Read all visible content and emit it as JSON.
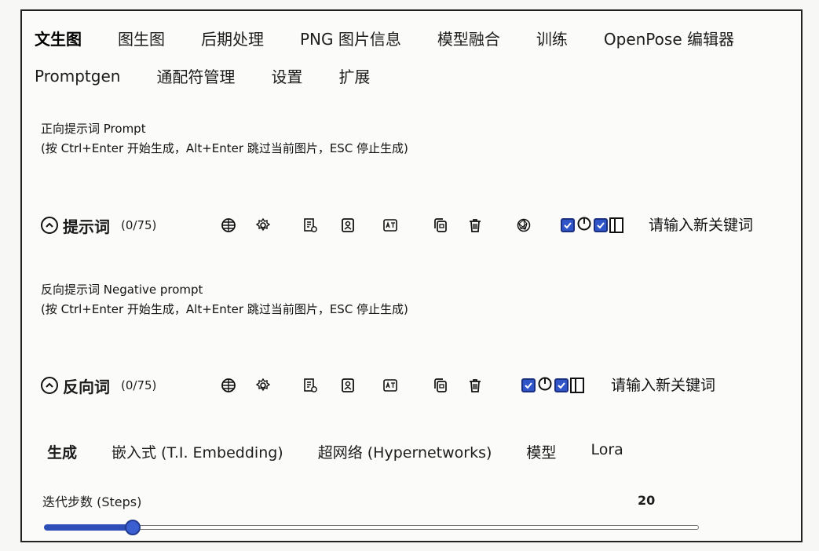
{
  "tabs_row1": [
    "文生图",
    "图生图",
    "后期处理",
    "PNG 图片信息",
    "模型融合",
    "训练",
    "OpenPose 编辑器"
  ],
  "tabs_row2": [
    "Promptgen",
    "通配符管理",
    "设置",
    "扩展"
  ],
  "active_tab": "文生图",
  "positive": {
    "label_line1": "正向提示词 Prompt",
    "label_line2": "(按 Ctrl+Enter 开始生成，Alt+Enter 跳过当前图片，ESC 停止生成)",
    "bar_title": "提示词",
    "counter": "(0/75)",
    "keyword_placeholder": "请输入新关键词"
  },
  "negative": {
    "label_line1": "反向提示词 Negative prompt",
    "label_line2": "(按 Ctrl+Enter 开始生成，Alt+Enter 跳过当前图片，ESC 停止生成)",
    "bar_title": "反向词",
    "counter": "(0/75)",
    "keyword_placeholder": "请输入新关键词"
  },
  "sub_tabs": [
    "生成",
    "嵌入式 (T.I. Embedding)",
    "超网络 (Hypernetworks)",
    "模型",
    "Lora"
  ],
  "active_sub_tab": "生成",
  "steps": {
    "label": "迭代步数 (Steps)",
    "value": "20",
    "fraction": 0.135
  },
  "icons": [
    "globe-icon",
    "settings-icon",
    "history-icon",
    "bookmark-icon",
    "translate-icon",
    "copy-icon",
    "trash-icon",
    "openai-icon"
  ],
  "colors": {
    "accent": "#2f55c8",
    "text": "#1c1c1c",
    "border": "#222222"
  }
}
